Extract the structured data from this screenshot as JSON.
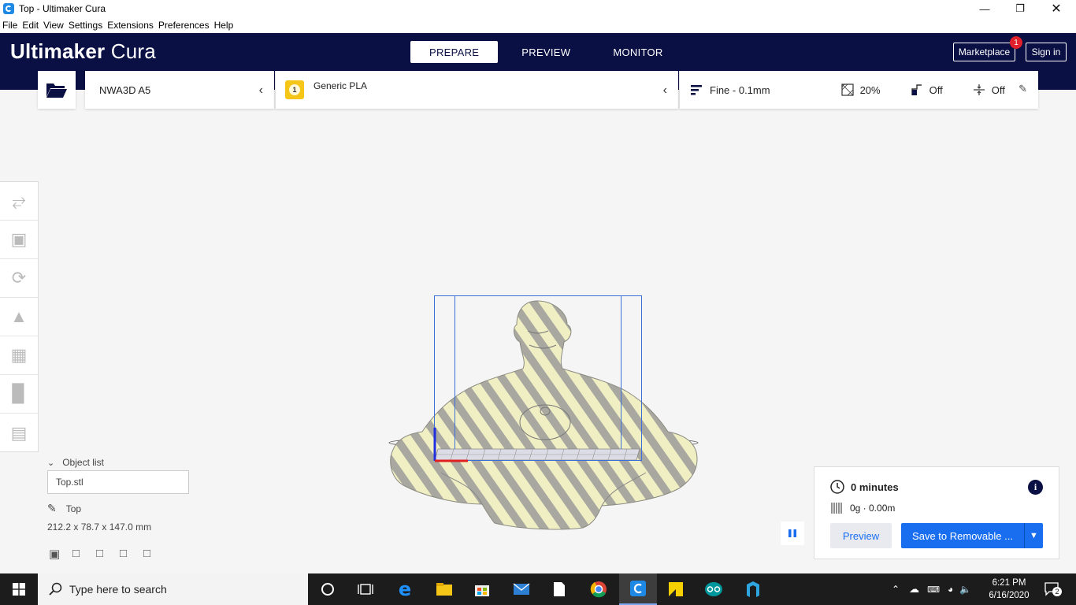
{
  "window": {
    "title": "Top - Ultimaker Cura"
  },
  "menu": [
    "File",
    "Edit",
    "View",
    "Settings",
    "Extensions",
    "Preferences",
    "Help"
  ],
  "header": {
    "logo_bold": "Ultimaker",
    "logo_light": " Cura",
    "tabs": [
      "PREPARE",
      "PREVIEW",
      "MONITOR"
    ],
    "marketplace": "Marketplace",
    "marketplace_badge": "1",
    "signin": "Sign in"
  },
  "setup": {
    "printer": "NWA3D A5",
    "material_slot": "1",
    "material": "Generic PLA",
    "profile": "Fine - 0.1mm",
    "infill": "20%",
    "support": "Off",
    "adhesion": "Off"
  },
  "object_list": {
    "title": "Object list",
    "file": "Top.stl",
    "name": "Top",
    "dims": "212.2 x 78.7 x 147.0 mm"
  },
  "summary": {
    "time": "0 minutes",
    "material": "0g · 0.00m",
    "preview_label": "Preview",
    "save_label": "Save to Removable ..."
  },
  "taskbar": {
    "search_placeholder": "Type here to search",
    "time": "6:21 PM",
    "date": "6/16/2020",
    "notifications": "2"
  },
  "colors": {
    "header_bg": "#0a0f44",
    "accent": "#196ef0",
    "model_fill": "#f0efc4",
    "model_stripe": "#a8a8a0"
  }
}
